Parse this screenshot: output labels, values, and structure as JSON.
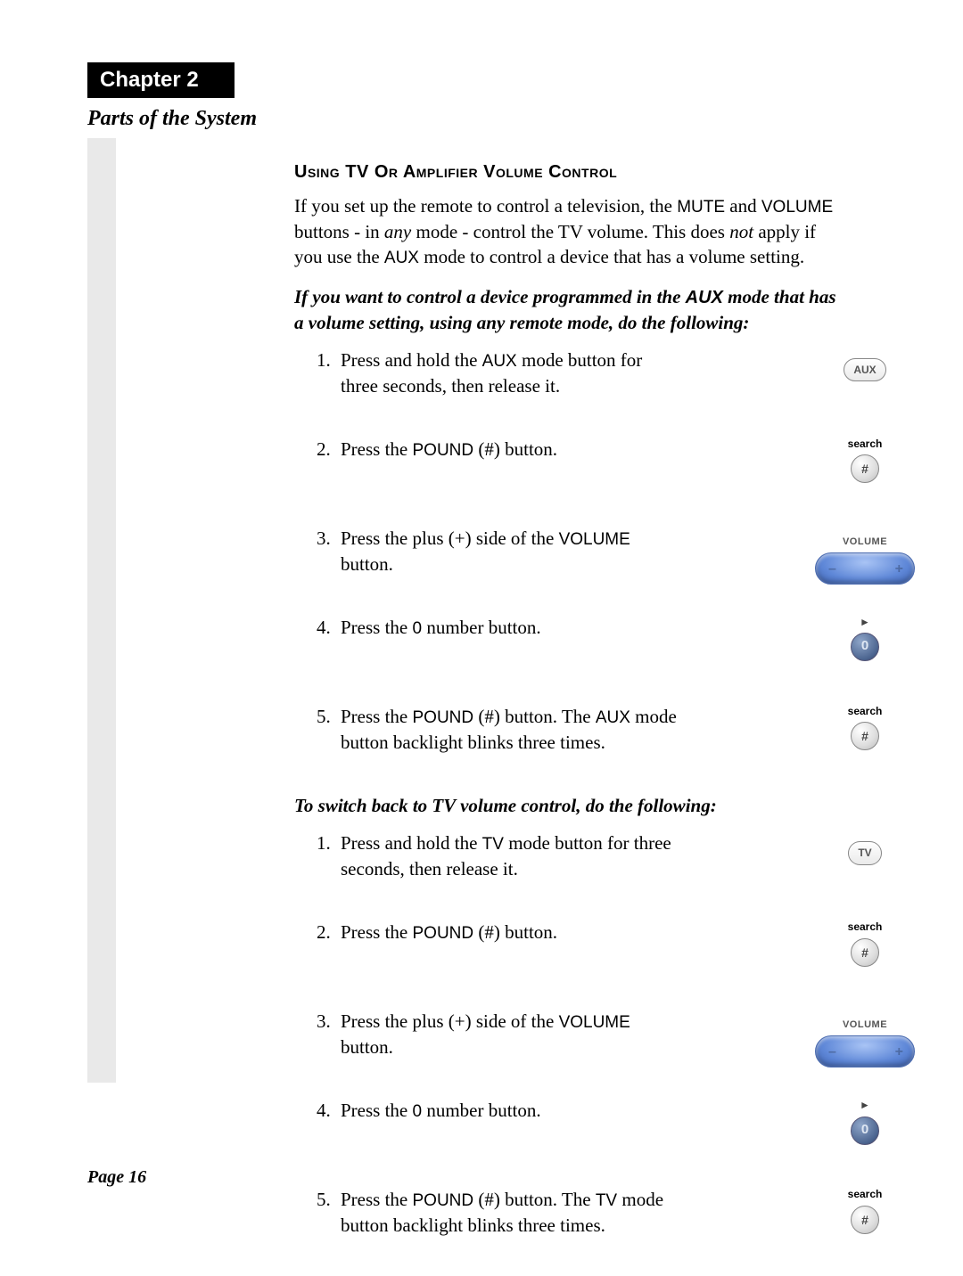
{
  "chapter_label": "Chapter 2",
  "section_title": "Parts of the System",
  "heading": "Using TV Or Amplifier Volume Control",
  "intro": {
    "p1a": "If you set up the remote to control a television, the ",
    "mute": "MUTE",
    "p1b": " and ",
    "volume": "VOLUME",
    "p1c": " buttons - in ",
    "any": "any",
    "p1d": " mode - control the TV volume. This does ",
    "not": "not",
    "p1e": " apply if you use the ",
    "aux": "AUX",
    "p1f": " mode to control a device that has a volume setting."
  },
  "sub1a": "If you want to control a device programmed in the ",
  "sub1_aux": "AUX",
  "sub1b": " mode that has a volume setting, using any remote mode, do the following:",
  "steps1": [
    {
      "a": "Press and hold the ",
      "k": "AUX",
      "b": " mode button for three seconds, then release it.",
      "icon": "aux"
    },
    {
      "a": "Press the ",
      "k": "POUND",
      "paren": " (#)",
      "b": " button.",
      "icon": "pound"
    },
    {
      "a": "Press the plus (+) side of the ",
      "k": "VOLUME",
      "b": " button.",
      "icon": "volume"
    },
    {
      "a": "Press the ",
      "k": "0",
      "b": " number button.",
      "icon": "zero"
    },
    {
      "a": "Press the ",
      "k": "POUND",
      "paren": " (#)",
      "b": " button. The ",
      "k2": "AUX",
      "c": " mode button backlight blinks three times.",
      "icon": "pound"
    }
  ],
  "sub2": "To switch back to TV volume control, do the following:",
  "steps2": [
    {
      "a": "Press and hold the ",
      "k": "TV",
      "b": " mode button for three seconds, then release it.",
      "icon": "tv"
    },
    {
      "a": "Press the ",
      "k": "POUND",
      "paren": " (#)",
      "b": " button.",
      "icon": "pound"
    },
    {
      "a": "Press the plus (+) side of the ",
      "k": "VOLUME",
      "b": " button.",
      "icon": "volume"
    },
    {
      "a": "Press the ",
      "k": "0",
      "b": " number button.",
      "icon": "zero"
    },
    {
      "a": "Press the ",
      "k": "POUND",
      "paren": " (#)",
      "b": " button. The ",
      "k2": "TV",
      "c": " mode button backlight blinks three times.",
      "icon": "pound"
    }
  ],
  "icon_labels": {
    "aux": "AUX",
    "tv": "TV",
    "pound_label": "search",
    "pound_glyph": "#",
    "volume": "VOLUME",
    "zero": "0",
    "zero_arrow": "►"
  },
  "page_label": "Page 16"
}
